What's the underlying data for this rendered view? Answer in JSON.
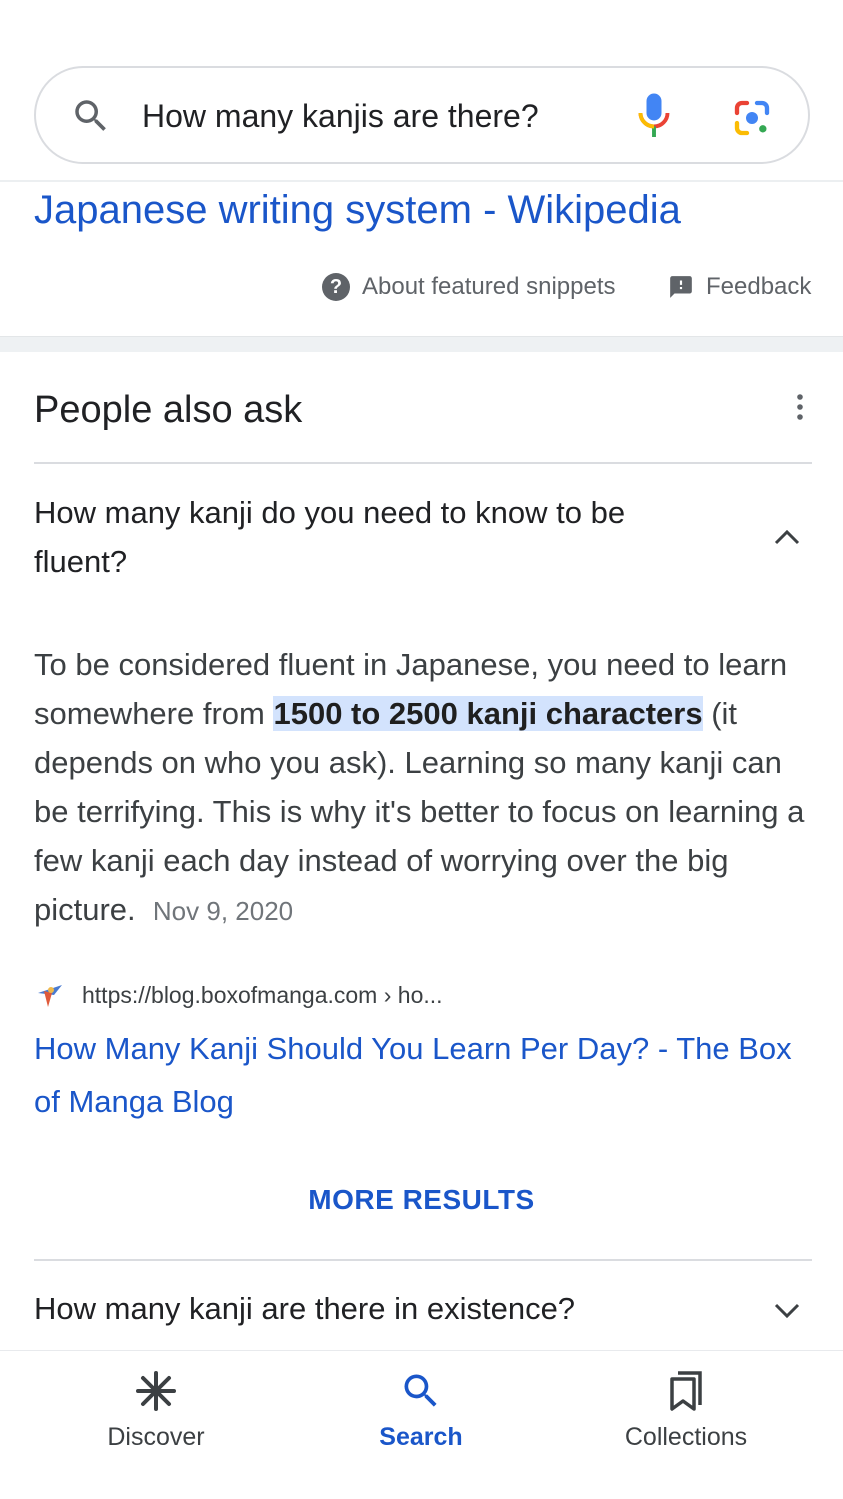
{
  "search": {
    "query": "How many kanjis are there?",
    "icons": [
      "search-icon",
      "mic-icon",
      "lens-icon"
    ]
  },
  "featured_snippet": {
    "link_title": "Japanese writing system - Wikipedia",
    "about_label": "About featured snippets",
    "feedback_label": "Feedback"
  },
  "people_also_ask": {
    "title": "People also ask",
    "expanded_question": "How many kanji do you need to know to be fluent?",
    "answer": {
      "before": "To be considered fluent in Japanese, you need to learn somewhere from ",
      "highlight": "1500 to 2500 kanji characters",
      "after": " (it depends on who you ask). Learning so many kanji can be terrifying. This is why it's better to focus on learning a few kanji each day instead of worrying over the big picture.",
      "date": "Nov 9, 2020"
    },
    "source_url": "https://blog.boxofmanga.com › ho...",
    "result_title": "How Many Kanji Should You Learn Per Day? - The Box of Manga Blog",
    "more_results_label": "MORE RESULTS",
    "collapsed_question": "How many kanji are there in existence?"
  },
  "bottom_nav": {
    "items": [
      {
        "label": "Discover",
        "icon": "asterisk-icon",
        "active": false
      },
      {
        "label": "Search",
        "icon": "search-icon",
        "active": true
      },
      {
        "label": "Collections",
        "icon": "bookmarks-icon",
        "active": false
      }
    ]
  },
  "colors": {
    "link": "#1a56c9",
    "highlight": "#d3e3fd",
    "text": "#202124",
    "muted": "#5f6368"
  }
}
